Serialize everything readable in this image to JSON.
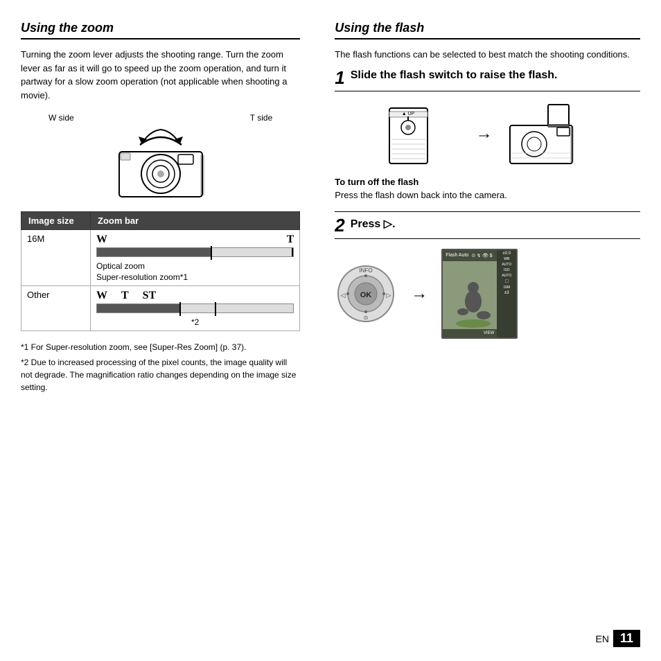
{
  "left": {
    "section_title": "Using the zoom",
    "body_text": "Turning the zoom lever adjusts the shooting range. Turn the zoom lever as far as it will go to speed up the zoom operation, and turn it partway for a slow zoom operation (not applicable when shooting a movie).",
    "diagram": {
      "w_side": "W side",
      "t_side": "T side"
    },
    "table": {
      "col1": "Image size",
      "col2": "Zoom bar",
      "rows": [
        {
          "size": "16M",
          "labels": "W     T",
          "text1": "Optical zoom",
          "text2": "Super-resolution zoom*1"
        },
        {
          "size": "Other",
          "labels": "W    T   ST",
          "text1": "*2"
        }
      ]
    },
    "footnotes": [
      "*1 For Super-resolution zoom, see [Super-Res Zoom] (p. 37).",
      "*2 Due to increased processing of the pixel counts, the image quality will not degrade. The magnification ratio changes depending on the image size setting."
    ]
  },
  "right": {
    "section_title": "Using the flash",
    "intro": "The flash functions can be selected to best match the shooting conditions.",
    "step1": {
      "number": "1",
      "text": "Slide the flash switch to raise the flash."
    },
    "turn_off": {
      "title": "To turn off the flash",
      "text": "Press the flash down back into the camera."
    },
    "step2": {
      "number": "2",
      "text": "Press ▷."
    },
    "camera_screen": {
      "top_label": "Flash Auto",
      "icon1": "⊙",
      "icon2": "↯",
      "icon3": "👁",
      "icon4": "$",
      "sidebar_items": [
        "±0.0",
        "WB AUTO",
        "ISO AUTO",
        "□",
        "16M",
        "±3"
      ],
      "bottom_label": "VIEW"
    }
  },
  "footer": {
    "en_label": "EN",
    "page_number": "11"
  }
}
